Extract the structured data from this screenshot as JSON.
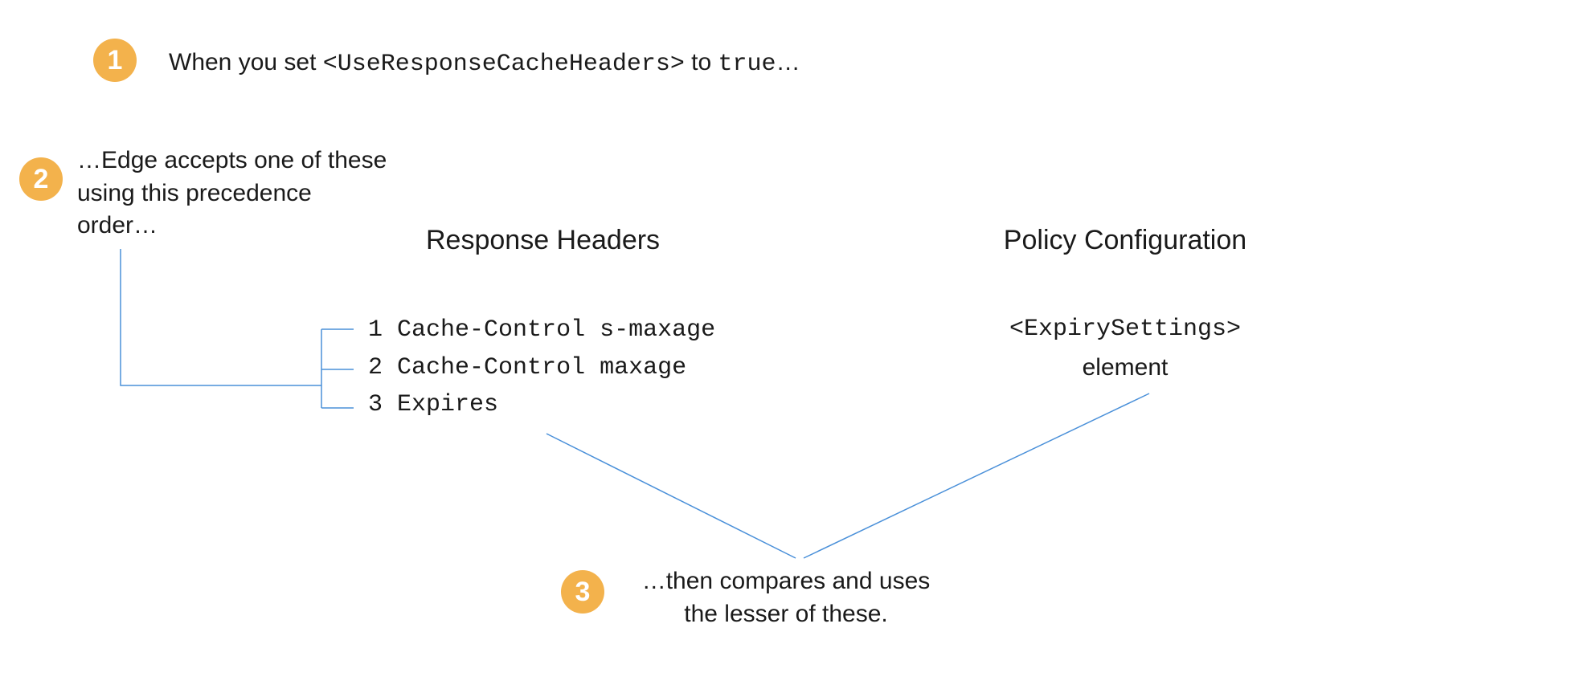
{
  "badges": {
    "one": "1",
    "two": "2",
    "three": "3"
  },
  "step1": {
    "prefix": "When you set ",
    "tag": "<UseResponseCacheHeaders>",
    "mid": " to ",
    "value": "true",
    "suffix": "…"
  },
  "step2": {
    "line1": "…Edge accepts one of these",
    "line2": "using this precedence",
    "line3": "order…"
  },
  "responseHeaders": {
    "title": "Response Headers",
    "items": [
      {
        "num": "1",
        "label": "Cache-Control s-maxage"
      },
      {
        "num": "2",
        "label": "Cache-Control maxage"
      },
      {
        "num": "3",
        "label": "Expires"
      }
    ]
  },
  "policy": {
    "title": "Policy Configuration",
    "tag": "<ExpirySettings>",
    "word": "element"
  },
  "step3": {
    "line1": "…then compares and uses",
    "line2": "the lesser of these."
  }
}
